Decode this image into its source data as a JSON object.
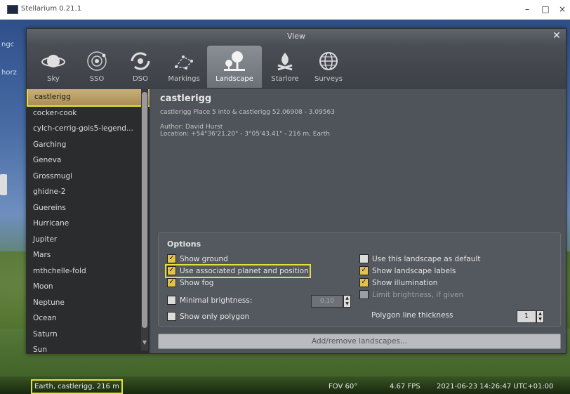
{
  "window": {
    "title": "Stellarium 0.21.1",
    "minimize": "–",
    "maximize": "□",
    "close": "×"
  },
  "sky": {
    "left_tag_1": "ngc",
    "left_tag_2": "horz"
  },
  "dialog": {
    "title": "View",
    "close": "✕",
    "tabs": [
      {
        "label": "Sky",
        "icon": "planet-icon"
      },
      {
        "label": "SSO",
        "icon": "solar-system-icon"
      },
      {
        "label": "DSO",
        "icon": "galaxy-icon"
      },
      {
        "label": "Markings",
        "icon": "markings-icon"
      },
      {
        "label": "Landscape",
        "icon": "tree-icon",
        "active": true
      },
      {
        "label": "Starlore",
        "icon": "campfire-icon"
      },
      {
        "label": "Surveys",
        "icon": "globe-icon"
      }
    ]
  },
  "landscapes": {
    "items": [
      "castlerigg",
      "cocker-cook",
      "cylch-cerrig-gois5-legend...",
      "Garching",
      "Geneva",
      "Grossmugl",
      "ghidne-2",
      "Guereins",
      "Hurricane",
      "Jupiter",
      "Mars",
      "mthchelle-fold",
      "Moon",
      "Neptune",
      "Ocean",
      "Saturn",
      "Sun"
    ],
    "selected_index": 0
  },
  "landscape_info": {
    "name": "castlerigg",
    "description": "castlerigg Place 5 into & castlerigg 52.06908 - 3.09563",
    "author": "Author: David Hurst",
    "location": "Location: +54°36'21.20\" - 3°05'43.41\" - 216 m, Earth"
  },
  "options": {
    "title": "Options",
    "show_ground": "Show ground",
    "use_associated": "Use associated planet and position",
    "show_fog": "Show fog",
    "minimal_brightness": "Minimal brightness:",
    "minimal_brightness_value": "0.10",
    "show_only_polygon": "Show only polygon",
    "use_as_default": "Use this landscape as default",
    "show_labels": "Show landscape labels",
    "show_illumination": "Show illumination",
    "limit_brightness": "Limit brightness, if given",
    "polygon_thickness": "Polygon line thickness",
    "polygon_thickness_value": "1",
    "checked": {
      "show_ground": true,
      "use_associated": true,
      "show_fog": true,
      "minimal_brightness": false,
      "show_only_polygon": false,
      "use_as_default": false,
      "show_labels": true,
      "show_illumination": true,
      "limit_brightness": false
    }
  },
  "add_remove_label": "Add/remove landscapes...",
  "status": {
    "location": "Earth, castlerigg, 216 m",
    "fov": "FOV 60°",
    "fps": "4.67 FPS",
    "datetime": "2021-06-23 14:26:47 UTC+01:00"
  },
  "colors": {
    "highlight": "#e4e03a",
    "selected_item": "#c9b07a",
    "dialog_bg": "#4a4e55"
  }
}
